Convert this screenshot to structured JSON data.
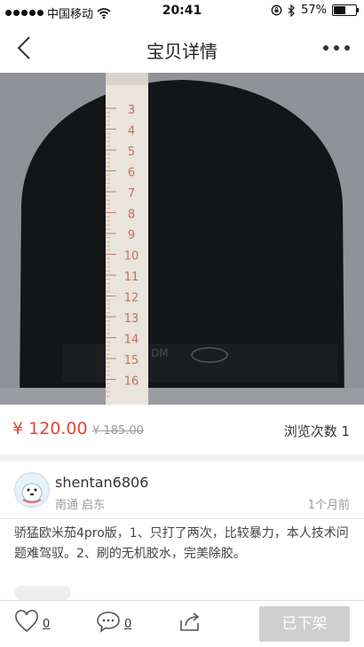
{
  "status_bar": {
    "carrier": "中国移动",
    "time": "20:41",
    "battery": "57%"
  },
  "nav": {
    "title": "宝贝详情"
  },
  "photo": {
    "ruler_numbers": [
      "3",
      "4",
      "5",
      "6",
      "7",
      "8",
      "9",
      "10",
      "11",
      "12",
      "13",
      "14",
      "15",
      "16"
    ]
  },
  "price": {
    "current": "¥ 120.00",
    "original": "¥ 185.00",
    "views": "浏览次数 1"
  },
  "seller": {
    "username": "shentan6806",
    "location": "南通 启东",
    "time_ago": "1个月前"
  },
  "description": "骄猛欧米茄4pro版，1、只打了两次，比较暴力，本人技术问题难驾驭。2、刷的无机胶水，完美除胶。",
  "toolbar": {
    "like_count": "0",
    "comment_count": "0",
    "delist_label": "已下架"
  }
}
